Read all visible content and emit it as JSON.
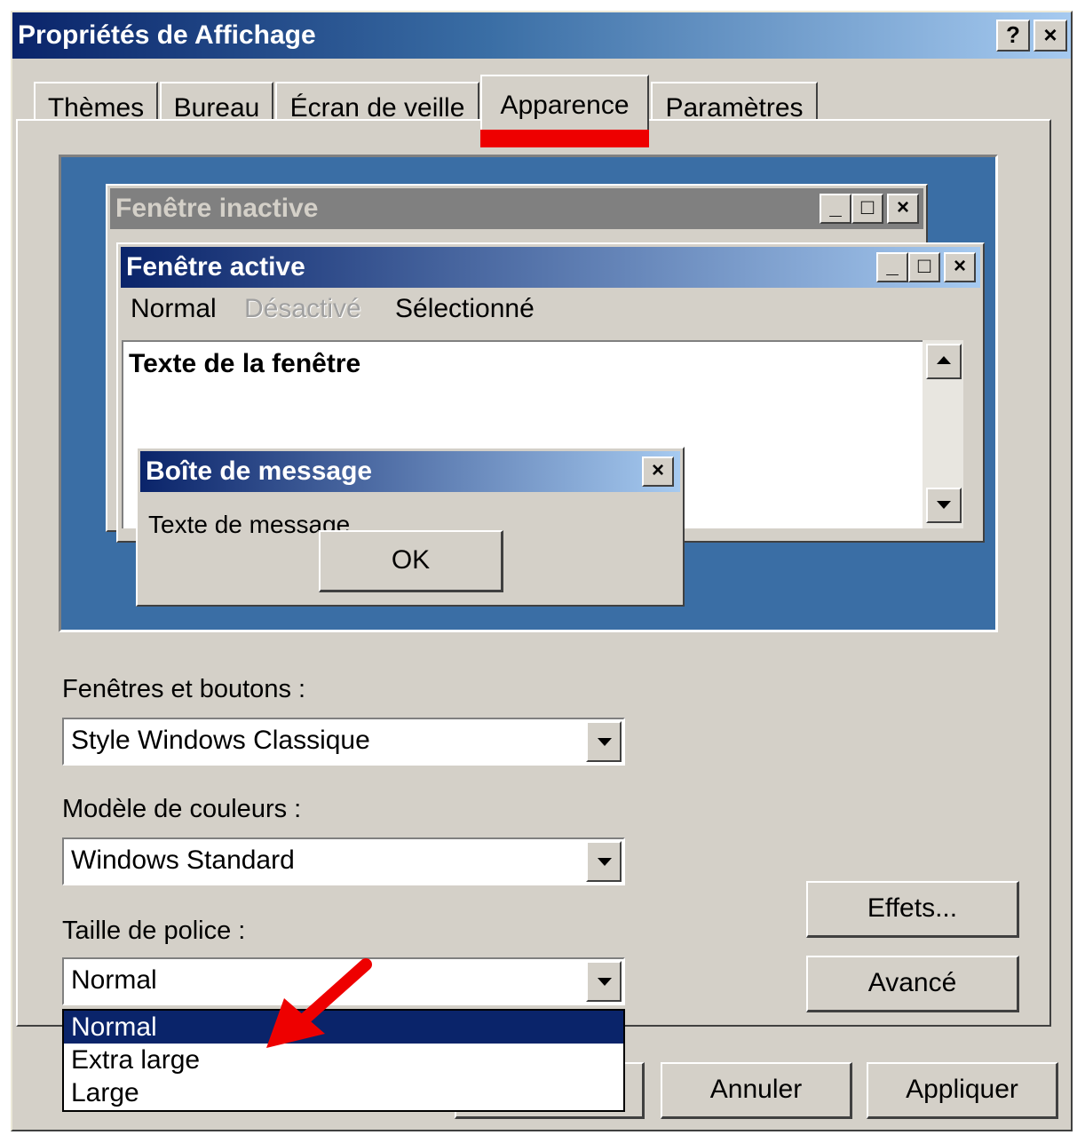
{
  "window": {
    "title": "Propriétés de Affichage",
    "help_label": "?",
    "close_label": "×"
  },
  "tabs": [
    {
      "label": "Thèmes"
    },
    {
      "label": "Bureau"
    },
    {
      "label": "Écran de veille"
    },
    {
      "label": "Apparence",
      "active": true
    },
    {
      "label": "Paramètres"
    }
  ],
  "preview": {
    "inactive_title": "Fenêtre inactive",
    "active_title": "Fenêtre active",
    "menu": {
      "normal": "Normal",
      "disabled": "Désactivé",
      "selected": "Sélectionné"
    },
    "window_text": "Texte de la fenêtre",
    "msgbox_title": "Boîte de message",
    "msgbox_text": "Texte de message",
    "ok_label": "OK",
    "min_glyph": "_",
    "max_glyph": "□",
    "close_glyph": "×"
  },
  "fields": {
    "windows_buttons_label": "Fenêtres et boutons :",
    "windows_buttons_value": "Style Windows Classique",
    "color_scheme_label": "Modèle de couleurs :",
    "color_scheme_value": "Windows Standard",
    "font_size_label": "Taille de police :",
    "font_size_value": "Normal"
  },
  "dropdown_options": [
    "Normal",
    "Extra large",
    "Large"
  ],
  "buttons": {
    "effects": "Effets...",
    "advanced": "Avancé",
    "cancel": "Annuler",
    "apply": "Appliquer"
  },
  "colors": {
    "title_active_start": "#0a246a",
    "title_active_end": "#a6caf0",
    "title_inactive": "#808080",
    "desktop": "#3a6ea5",
    "annotation": "#ee0000"
  }
}
